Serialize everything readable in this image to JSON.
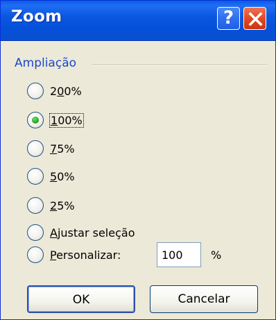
{
  "window": {
    "title": "Zoom",
    "help_glyph": "?",
    "close_icon": "close-icon"
  },
  "group": {
    "legend": "Ampliação"
  },
  "options": [
    {
      "pre": "2",
      "mn": "0",
      "post": "0%",
      "selected": false
    },
    {
      "pre": "",
      "mn": "1",
      "post": "00%",
      "selected": true,
      "focused": true
    },
    {
      "pre": "",
      "mn": "7",
      "post": "5%",
      "selected": false
    },
    {
      "pre": "",
      "mn": "5",
      "post": "0%",
      "selected": false
    },
    {
      "pre": "",
      "mn": "2",
      "post": "5%",
      "selected": false
    },
    {
      "pre": "",
      "mn": "A",
      "post": "justar seleção",
      "selected": false
    },
    {
      "pre": "",
      "mn": "P",
      "post": "ersonalizar:",
      "selected": false
    }
  ],
  "custom": {
    "value": "100",
    "unit": "%"
  },
  "buttons": {
    "ok": "OK",
    "cancel": "Cancelar"
  },
  "colors": {
    "titlebar": "#0a57e0",
    "legend": "#1b47c8",
    "radio_dot": "#29a629",
    "close_button": "#e04a24"
  }
}
